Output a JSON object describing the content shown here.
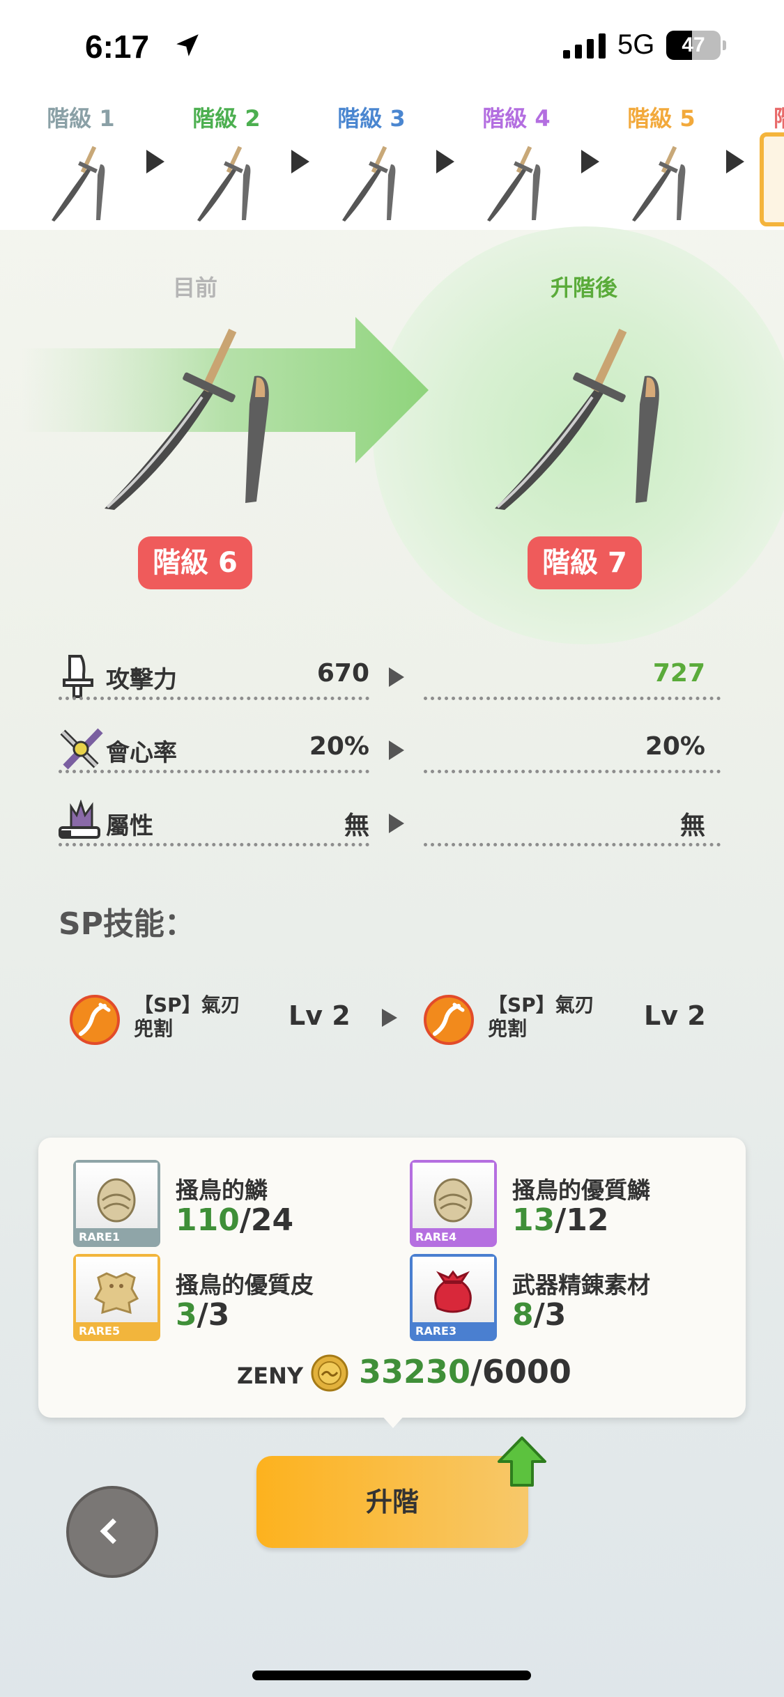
{
  "status_bar": {
    "time": "6:17",
    "network": "5G",
    "battery": "47",
    "battery_level": 0.47
  },
  "tiers": [
    {
      "label": "階級 1",
      "color": "#8aa0a6"
    },
    {
      "label": "階級 2",
      "color": "#4caf50"
    },
    {
      "label": "階級 3",
      "color": "#4a86d0"
    },
    {
      "label": "階級 4",
      "color": "#b36ee0"
    },
    {
      "label": "階級 5",
      "color": "#f2a93b"
    },
    {
      "label": "階",
      "color": "#e86a6a"
    }
  ],
  "compare": {
    "current_label": "目前",
    "after_label": "升階後",
    "current_rank": "階級 6",
    "after_rank": "階級 7"
  },
  "stats": [
    {
      "icon": "blade-icon",
      "name": "攻擊力",
      "current": "670",
      "after": "727",
      "after_color": "#5aab3a"
    },
    {
      "icon": "crossed-swords-icon",
      "name": "會心率",
      "current": "20%",
      "after": "20%",
      "after_color": "#333333"
    },
    {
      "icon": "element-flame-icon",
      "name": "屬性",
      "current": "無",
      "after": "無",
      "after_color": "#333333"
    }
  ],
  "sp": {
    "title": "SP技能：",
    "current": {
      "name_line1": "【SP】氣刃",
      "name_line2": "兜割",
      "level": "Lv 2"
    },
    "after": {
      "name_line1": "【SP】氣刃",
      "name_line2": "兜割",
      "level": "Lv 2"
    }
  },
  "materials": [
    {
      "name": "搔鳥的鱗",
      "have": "110",
      "need": "/24",
      "rare": "RARE1",
      "rare_color": "#8fa5a8",
      "icon": "scale-icon"
    },
    {
      "name": "搔鳥的優質鱗",
      "have": "13",
      "need": "/12",
      "rare": "RARE4",
      "rare_color": "#b56fe0",
      "icon": "scale-icon"
    },
    {
      "name": "搔鳥的優質皮",
      "have": "3",
      "need": "/3",
      "rare": "RARE5",
      "rare_color": "#f2b53c",
      "icon": "hide-icon"
    },
    {
      "name": "武器精錬素材",
      "have": "8",
      "need": "/3",
      "rare": "RARE3",
      "rare_color": "#4a7fd0",
      "icon": "pouch-icon"
    }
  ],
  "zeny": {
    "label": "ZENY",
    "have": "33230",
    "need": "/6000"
  },
  "buttons": {
    "upgrade": "升階"
  }
}
